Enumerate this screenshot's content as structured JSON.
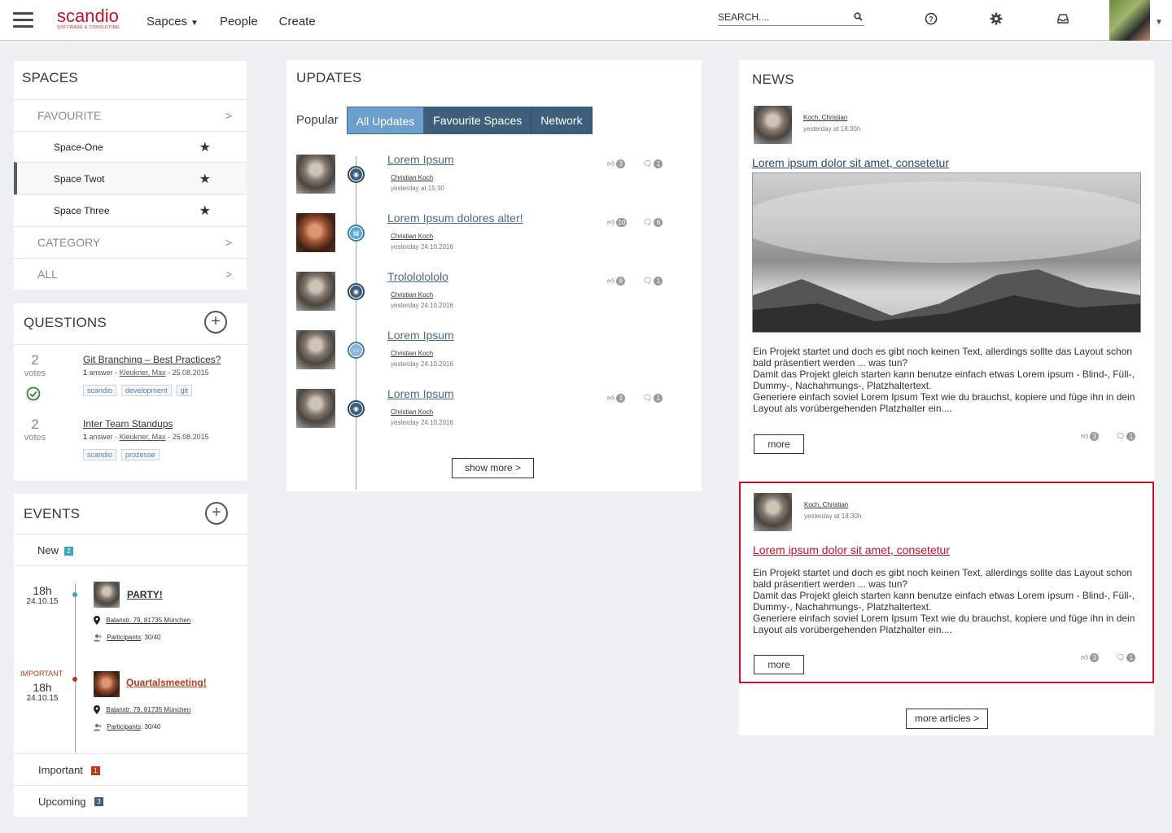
{
  "header": {
    "logo_name": "scandio",
    "logo_sub": "SOFTWARE & CONSULTING",
    "nav": [
      "Sapces",
      "People",
      "Create"
    ],
    "search_placeholder": "SEARCH....",
    "icons": [
      "help-icon",
      "gear-icon",
      "inbox-icon"
    ]
  },
  "spaces": {
    "title": "SPACES",
    "favourite_label": "FAVOURITE",
    "items": [
      "Space-One",
      "Space Twot",
      "Space Three"
    ],
    "category_label": "CATEGORY",
    "all_label": "ALL",
    "arrow": ">"
  },
  "questions": {
    "title": "QUESTIONS",
    "items": [
      {
        "votes": "2",
        "votes_label": "votes",
        "title": "Git Branching – Best Practices?",
        "answers": "1",
        "answer_label": "answer -",
        "author": "Kleukner, Max",
        "date": "- 25.08.2015",
        "tags": [
          "scandio",
          "development",
          "git"
        ]
      },
      {
        "votes": "2",
        "votes_label": "votes",
        "title": "Inter Team Standups",
        "answers": "1",
        "answer_label": "answer -",
        "author": "Kleukner, Max",
        "date": "- 25.08.2015",
        "tags": [
          "scandio",
          "prozesse"
        ]
      }
    ]
  },
  "events": {
    "title": "EVENTS",
    "new_label": "New",
    "new_count": "2",
    "items": [
      {
        "hour": "18h",
        "date": "24.10.15",
        "title": "PARTY!",
        "address": "Balanstr. 79, 81735 München",
        "participants_label": "Participants",
        "participants": ": 30/40"
      },
      {
        "flag": "IMPORTANT",
        "hour": "18h",
        "date": "24.10.15",
        "title": "Quartalsmeeting!",
        "address": "Balanstr. 79, 81735 München",
        "participants_label": "Participants",
        "participants": ": 30/40"
      }
    ],
    "important_label": "Important",
    "important_count": "1",
    "upcoming_label": "Upcoming",
    "upcoming_count": "3",
    "colors": {
      "new": "#3aa6b8",
      "important": "#c0391b",
      "upcoming": "#3d5f7c"
    }
  },
  "updates": {
    "title": "UPDATES",
    "tabs": [
      "Popular",
      "All Updates",
      "Favourite Spaces",
      "Network"
    ],
    "selected_tab": "All Updates",
    "items": [
      {
        "title": "Lorem Ipsum",
        "author": "Christian Koch",
        "time": "yesterday at 15:30",
        "likes": "3",
        "comments": "1",
        "icon": "rss-icon"
      },
      {
        "title": "Lorem Ipsum dolores alter!",
        "author": "Christian Koch",
        "time": "yesterday 24.10.2016",
        "likes": "10",
        "comments": "6",
        "icon": "page-icon"
      },
      {
        "title": "Trolololololo",
        "author": "Christian Koch",
        "time": "yesterday 24.10.2016",
        "likes": "8",
        "comments": "1",
        "icon": "rss-icon"
      },
      {
        "title": "Lorem Ipsum",
        "author": "Christian Koch",
        "time": "yesterday 24.10.2016",
        "icon": "comment-icon"
      },
      {
        "title": "Lorem Ipsum",
        "author": "Christian Koch",
        "time": "yesterday 24.10.2016",
        "likes": "3",
        "comments": "1",
        "icon": "rss-icon"
      }
    ],
    "show_more": "show more >"
  },
  "news": {
    "title": "NEWS",
    "articles": [
      {
        "author": "Koch, Christian",
        "time": "yesterday at 18:30h",
        "title": "Lorem ipsum dolor sit amet,  consetetur",
        "body": [
          "Ein Projekt startet und doch es gibt noch keinen Text, allerdings sollte das Layout schon bald präsentiert werden ... was tun?",
          "Damit das Projekt gleich starten kann benutze einfach etwas Lorem ipsum - Blind-, Füll-, Dummy-, Nachahmungs-, Platzhaltertext.",
          "Generiere einfach soviel Lorem Ipsum Text wie du brauchst, kopiere und füge ihn in dein Layout als vorübergehenden Platzhalter ein...."
        ],
        "more": "more",
        "likes": "3",
        "comments": "1"
      },
      {
        "author": "Koch, Christian",
        "time": "yesterday at 18:30h",
        "title": "Lorem ipsum dolor sit amet,  consetetur",
        "body": [
          "Ein Projekt startet und doch es gibt noch keinen Text, allerdings sollte das Layout schon bald präsentiert werden ... was tun?",
          "Damit das Projekt gleich starten kann benutze einfach etwas Lorem ipsum - Blind-, Füll-, Dummy-, Nachahmungs-, Platzhaltertext.",
          "Generiere einfach soviel Lorem Ipsum Text wie du brauchst, kopiere und füge ihn in dein Layout als vorübergehenden Platzhalter ein...."
        ],
        "more": "more",
        "likes": "3",
        "comments": "1"
      }
    ],
    "more_articles": "more articles >",
    "highlight_color": "#c8102e"
  }
}
